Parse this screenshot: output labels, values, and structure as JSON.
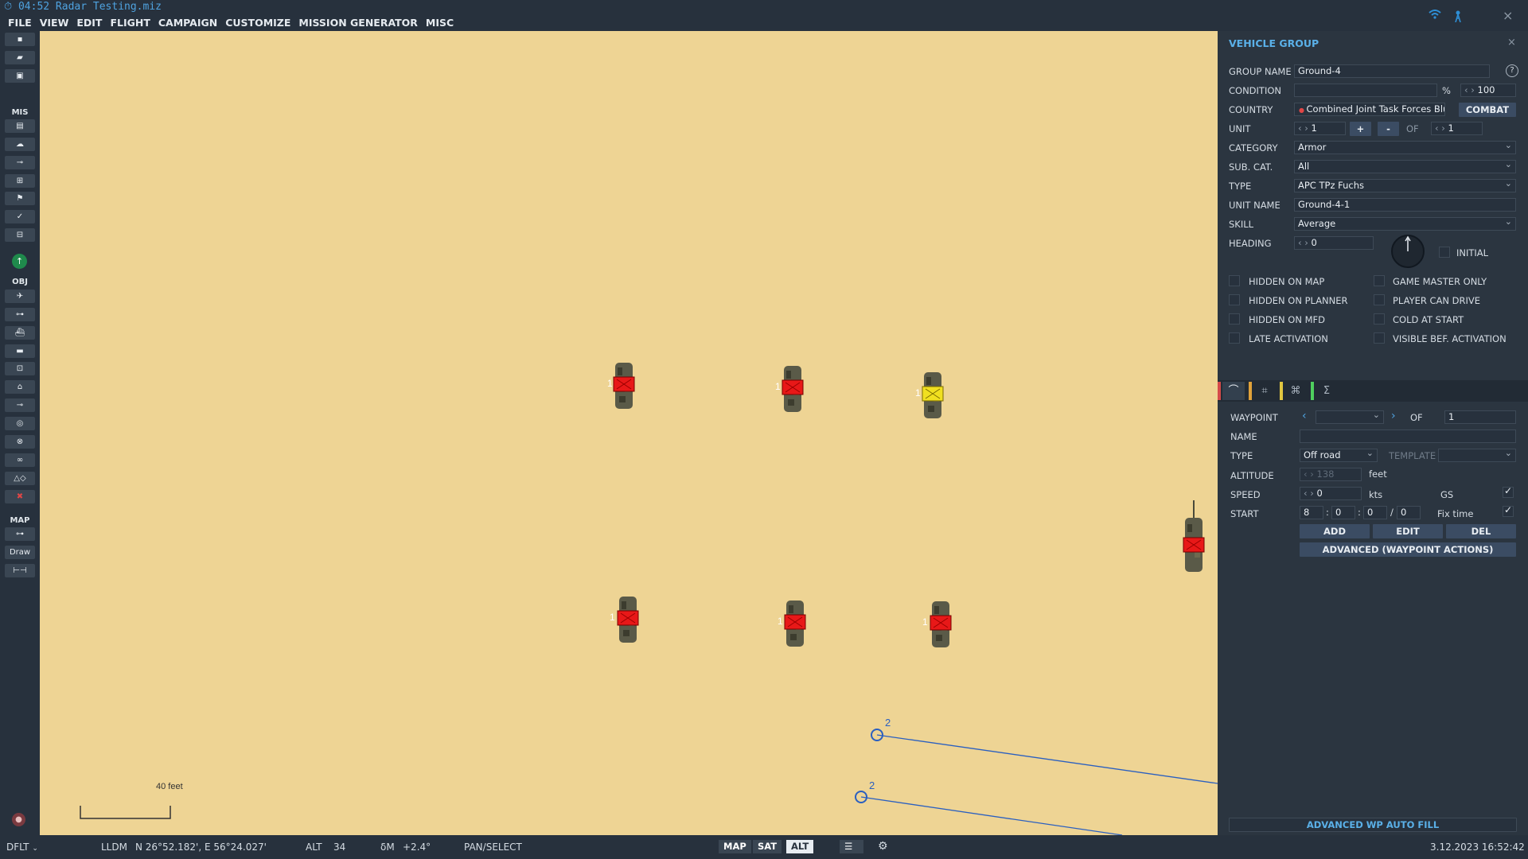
{
  "window": {
    "title": "04:52 Radar Testing.miz"
  },
  "menu": [
    "FILE",
    "VIEW",
    "EDIT",
    "FLIGHT",
    "CAMPAIGN",
    "CUSTOMIZE",
    "MISSION GENERATOR",
    "MISC"
  ],
  "toolbar": {
    "mis_label": "MIS",
    "obj_label": "OBJ",
    "map_label": "MAP",
    "draw_label": "Draw"
  },
  "map": {
    "scale_label": "40 feet",
    "waypoints": [
      {
        "label": "2"
      },
      {
        "label": "2"
      }
    ],
    "vehicle_label": "1"
  },
  "panel": {
    "title": "VEHICLE GROUP",
    "help": "?",
    "group_name_label": "GROUP NAME",
    "group_name": "Ground-4",
    "condition_label": "CONDITION",
    "condition_unit": "%",
    "condition_value": "100",
    "country_label": "COUNTRY",
    "country": "Combined Joint Task Forces Blue",
    "combat": "COMBAT",
    "unit_label": "UNIT",
    "unit_value": "1",
    "plus": "+",
    "minus": "-",
    "of_label": "OF",
    "unit_total": "1",
    "category_label": "CATEGORY",
    "category": "Armor",
    "subcat_label": "SUB. CAT.",
    "subcat": "All",
    "type_label": "TYPE",
    "type": "APC TPz Fuchs",
    "unit_name_label": "UNIT NAME",
    "unit_name": "Ground-4-1",
    "skill_label": "SKILL",
    "skill": "Average",
    "heading_label": "HEADING",
    "heading": "0",
    "initial_label": "INITIAL",
    "checks_left": [
      "HIDDEN ON MAP",
      "HIDDEN ON PLANNER",
      "HIDDEN ON MFD",
      "LATE ACTIVATION"
    ],
    "checks_right": [
      "GAME MASTER ONLY",
      "PLAYER CAN DRIVE",
      "COLD AT START",
      "VISIBLE BEF. ACTIVATION"
    ],
    "tab_colors": [
      "#d44a4a",
      "#e0a23a",
      "#e0c640",
      "#4fcf5e"
    ],
    "wp": {
      "waypoint_label": "WAYPOINT",
      "waypoint_of": "OF",
      "waypoint_total": "1",
      "name_label": "NAME",
      "type_label": "TYPE",
      "type": "Off road",
      "template_label": "TEMPLATE",
      "altitude_label": "ALTITUDE",
      "altitude": "138",
      "altitude_unit": "feet",
      "speed_label": "SPEED",
      "speed": "0",
      "speed_unit": "kts",
      "gs_label": "GS",
      "start_label": "START",
      "start_h": "8",
      "start_m": "0",
      "start_s": "0",
      "start_d": "0",
      "fix_time_label": "Fix time",
      "add": "ADD",
      "edit": "EDIT",
      "del": "DEL",
      "advanced": "ADVANCED (WAYPOINT ACTIONS)"
    },
    "auto_fill": "ADVANCED WP AUTO FILL"
  },
  "status": {
    "profile": "DFLT",
    "coord_mode": "LLDM",
    "coords": "N 26°52.182', E 56°24.027'",
    "alt_label": "ALT",
    "alt": "34",
    "dm_label": "δM",
    "dm": "+2.4°",
    "mode": "PAN/SELECT",
    "map_btn": "MAP",
    "sat_btn": "SAT",
    "alt_btn": "ALT",
    "datetime": "3.12.2023 16:52:42"
  }
}
